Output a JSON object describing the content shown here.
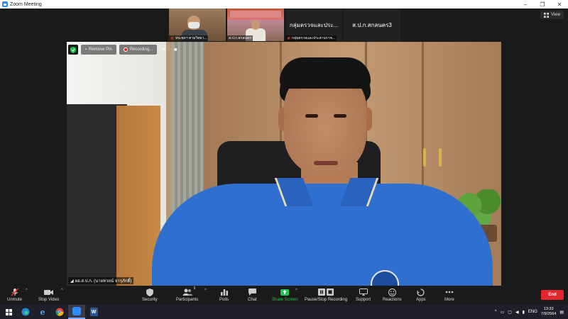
{
  "window": {
    "title": "Zoom Meeting",
    "controls": [
      "–",
      "❐",
      "✕"
    ]
  },
  "view_button": {
    "label": "View"
  },
  "thumbnails": [
    {
      "type": "video",
      "label": "หน.ชุดฯ",
      "label_full": "หน.ชุดฯ ตามวิทยา...",
      "muted": true
    },
    {
      "type": "video",
      "label": "ส.ป.ก.สกลนคร",
      "muted": false
    },
    {
      "type": "name",
      "name": "กลุ่มตรวจและประ...",
      "label": "กลุ่มตรวจและประสานราช...",
      "muted": true
    },
    {
      "type": "name",
      "name": "ส.ป.ก.สกลนคร3",
      "label": "",
      "muted": false
    }
  ],
  "overlay": {
    "remove_pin_label": "Remove Pin",
    "recording_label": "Recording...",
    "pause_icon": "⏸",
    "stop_icon": "■"
  },
  "main_video": {
    "name_label": "ผอ.ส.ป.ก. (นายทวยน์ จารุภักดิ์)"
  },
  "toolbar": {
    "unmute": "Unmute",
    "stop_video": "Stop Video",
    "security": "Security",
    "participants": "Participants",
    "participants_count": "5",
    "polls": "Polls",
    "chat": "Chat",
    "share_screen": "Share Screen",
    "pause_stop_recording": "Pause/Stop Recording",
    "support": "Support",
    "reactions": "Reactions",
    "apps": "Apps",
    "more": "More",
    "end": "End"
  },
  "taskbar": {
    "language": "ENG",
    "time": "13:33",
    "date": "7/9/2564"
  },
  "colors": {
    "accent_green": "#23c552",
    "end_red": "#e0282e",
    "zoom_blue": "#2d8cff"
  }
}
